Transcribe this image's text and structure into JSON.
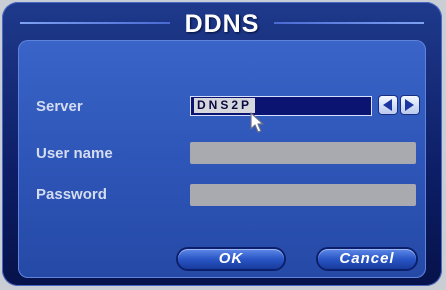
{
  "dialog": {
    "title": "DDNS"
  },
  "fields": {
    "server_label": "Server",
    "server_value": "DNS2P",
    "user_label": "User name",
    "user_value": "",
    "password_label": "Password",
    "password_value": ""
  },
  "buttons": {
    "ok": "OK",
    "cancel": "Cancel"
  },
  "icons": {
    "prev": "arrow-left-icon",
    "next": "arrow-right-icon",
    "cursor": "mouse-pointer-icon"
  },
  "colors": {
    "frame": "#0d1e66",
    "panel": "#2e56b8",
    "input": "#a8aaaf",
    "select_bg": "#0b1470"
  }
}
